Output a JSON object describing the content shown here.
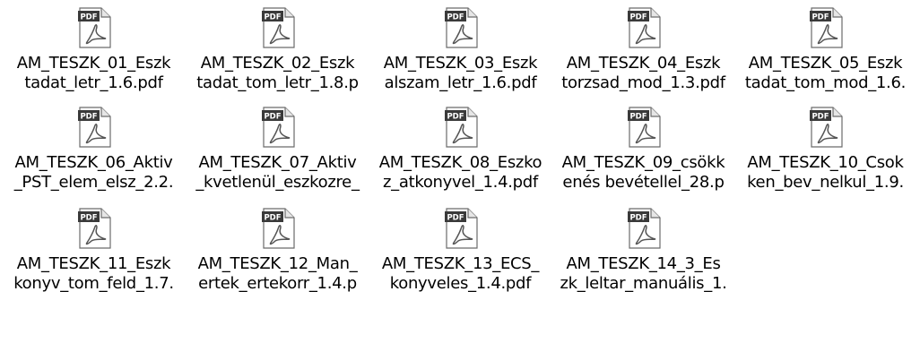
{
  "files": [
    {
      "line1": "AM_TESZK_01_Eszk",
      "line2": "tadat_letr_1.6.pdf",
      "icon": "pdf-file-icon"
    },
    {
      "line1": "AM_TESZK_02_Eszk",
      "line2": "tadat_tom_letr_1.8.p",
      "icon": "pdf-file-icon"
    },
    {
      "line1": "AM_TESZK_03_Eszk",
      "line2": "alszam_letr_1.6.pdf",
      "icon": "pdf-file-icon"
    },
    {
      "line1": "AM_TESZK_04_Eszk",
      "line2": "torzsad_mod_1.3.pdf",
      "icon": "pdf-file-icon"
    },
    {
      "line1": "AM_TESZK_05_Eszk",
      "line2": "tadat_tom_mod_1.6.",
      "icon": "pdf-file-icon"
    },
    {
      "line1": "AM_TESZK_06_Aktiv",
      "line2": "_PST_elem_elsz_2.2.",
      "icon": "pdf-file-icon"
    },
    {
      "line1": "AM_TESZK_07_Aktiv",
      "line2": "_kvetlenül_eszkozre_",
      "icon": "pdf-file-icon"
    },
    {
      "line1": "AM_TESZK_08_Eszko",
      "line2": "z_atkonyvel_1.4.pdf",
      "icon": "pdf-file-icon"
    },
    {
      "line1": "AM_TESZK_09_csökk",
      "line2": "enés bevétellel_28.p",
      "icon": "pdf-file-icon"
    },
    {
      "line1": "AM_TESZK_10_Csok",
      "line2": "ken_bev_nelkul_1.9.",
      "icon": "pdf-file-icon"
    },
    {
      "line1": "AM_TESZK_11_Eszk",
      "line2": "konyv_tom_feld_1.7.",
      "icon": "pdf-file-icon"
    },
    {
      "line1": "AM_TESZK_12_Man_",
      "line2": "ertek_ertekorr_1.4.p",
      "icon": "pdf-file-icon"
    },
    {
      "line1": "AM_TESZK_13_ECS_",
      "line2": "konyveles_1.4.pdf",
      "icon": "pdf-file-icon"
    },
    {
      "line1": "AM_TESZK_14_3_Es",
      "line2": "zk_leltar_manuális_1.",
      "icon": "pdf-file-icon"
    }
  ],
  "icon_badge_text": "PDF",
  "colors": {
    "background": "#ffffff",
    "text": "#000000",
    "badge": "#3a3a3a",
    "acrobat_mark": "#555555"
  }
}
